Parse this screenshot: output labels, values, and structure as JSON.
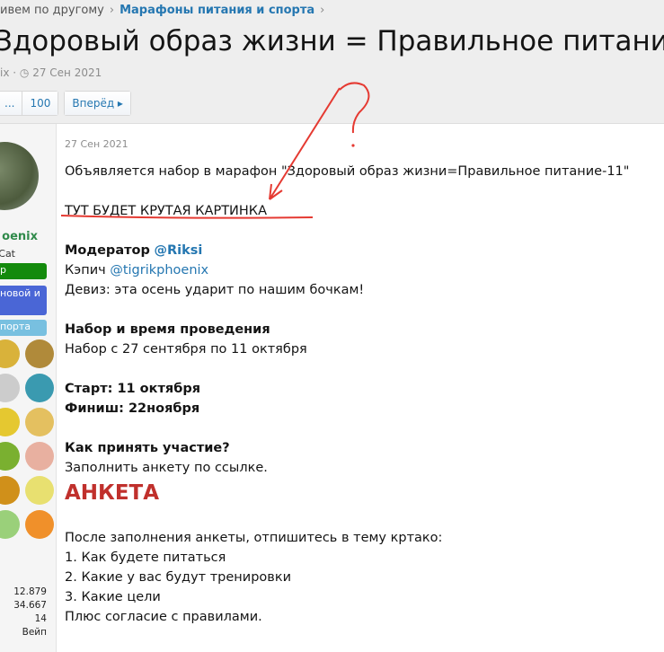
{
  "breadcrumbs": [
    "ивем по другому",
    "Марафоны питания и спорта"
  ],
  "title": "Здоровый образ жизни = Правильное питание",
  "meta": {
    "author": "ix",
    "date": "27 Сен 2021"
  },
  "pager": {
    "ellipsis": "...",
    "last": "100",
    "next": "Вперёд ▸"
  },
  "user": {
    "name": "oenix",
    "title": "Cat",
    "badges": [
      "р",
      "новой и",
      "порта"
    ],
    "stats": [
      "12.879",
      "34.667",
      "14",
      "Вейп"
    ]
  },
  "post": {
    "date": "27 Сен 2021",
    "intro": "Объявляется набор в марафон \"Здоровый образ жизни=Правильное питание-11\"",
    "placeholder": "ТУТ БУДЕТ КРУТАЯ КАРТИНКА",
    "moderator_label": "Модератор",
    "moderator": "@Riksi",
    "captain_label": "Кэпич",
    "captain": "@tigrikphoenix",
    "motto": "Девиз: эта осень ударит по нашим бочкам!",
    "schedule_title": "Набор и время проведения",
    "schedule": "Набор с 27 сентября по 11 октября",
    "start": "Старт: 11 октября",
    "finish": "Финиш: 22ноября",
    "how_title": "Как принять участие?",
    "how": "Заполнить анкету по ссылке.",
    "form_link": "АНКЕТА",
    "after": "После заполнения анкеты, отпишитесь в тему кртако:",
    "list": [
      "1. Как будете питаться",
      "2. Какие у вас будут тренировки",
      "3. Какие цели"
    ],
    "footer": "Плюс согласие с правилами."
  },
  "annotation": {
    "mark": "?"
  }
}
